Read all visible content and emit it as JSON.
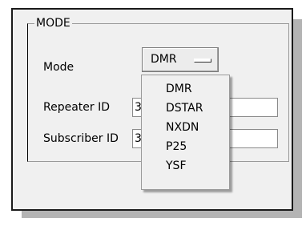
{
  "group": {
    "title": "MODE"
  },
  "fields": {
    "mode_label": "Mode",
    "mode_value": "DMR",
    "repeater_label": "Repeater ID",
    "repeater_value": "3",
    "subscriber_label": "Subscriber ID",
    "subscriber_value": "3"
  },
  "menu": {
    "items": [
      "DMR",
      "DSTAR",
      "NXDN",
      "P25",
      "YSF"
    ]
  }
}
